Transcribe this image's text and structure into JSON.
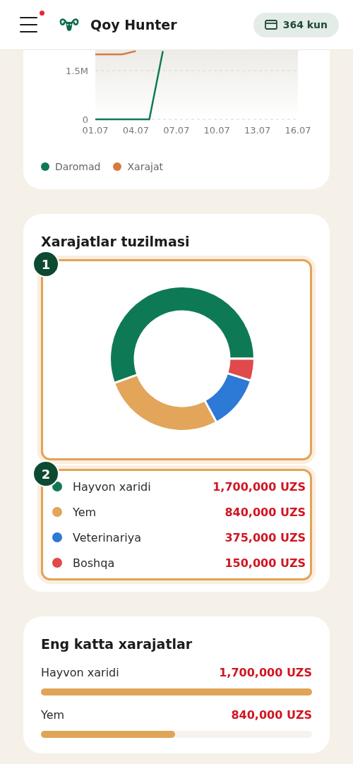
{
  "header": {
    "app_name": "Qoy Hunter",
    "notification_dot": true,
    "days_pill": "364 kun"
  },
  "income_chart": {
    "chart_data": {
      "type": "line",
      "categories": [
        "01.07",
        null,
        null,
        "04.07",
        null,
        null,
        "07.07",
        null,
        null,
        "10.07",
        null,
        null,
        "13.07",
        null,
        null,
        "16.07"
      ],
      "ylim": [
        0,
        2130000
      ],
      "yticks": [
        {
          "value": 0,
          "label": "0"
        },
        {
          "value": 1500000,
          "label": "1.5M"
        }
      ],
      "series": [
        {
          "name": "Daromad",
          "color": "#0e7a55",
          "values": [
            0,
            0,
            0,
            0,
            0,
            2100000,
            null,
            null,
            null,
            null,
            null,
            null,
            null,
            null,
            null,
            null
          ]
        },
        {
          "name": "Xarajat",
          "color": "#d77a42",
          "values": [
            2000000,
            2000000,
            2000000,
            2100000,
            null,
            null,
            null,
            null,
            null,
            null,
            null,
            null,
            null,
            null,
            null,
            null
          ]
        }
      ]
    }
  },
  "structure": {
    "title": "Xarajatlar tuzilmasi",
    "chart_badge": "1",
    "legend_badge": "2",
    "chart_data": {
      "type": "donut",
      "values": [
        55.5,
        27.4,
        12.2,
        4.9
      ]
    },
    "legend": [
      {
        "label": "Hayvon xaridi",
        "value": "1,700,000 UZS",
        "color": "#0e7a55"
      },
      {
        "label": "Yem",
        "value": "840,000 UZS",
        "color": "#e2a55a"
      },
      {
        "label": "Veterinariya",
        "value": "375,000 UZS",
        "color": "#2c79d6"
      },
      {
        "label": "Boshqa",
        "value": "150,000 UZS",
        "color": "#e04a4a"
      }
    ]
  },
  "top_expenses": {
    "title": "Eng katta xarajatlar",
    "items": [
      {
        "label": "Hayvon xaridi",
        "value": "1,700,000 UZS",
        "level": 1
      },
      {
        "label": "Yem",
        "value": "840,000 UZS",
        "level": 0.494
      }
    ]
  }
}
